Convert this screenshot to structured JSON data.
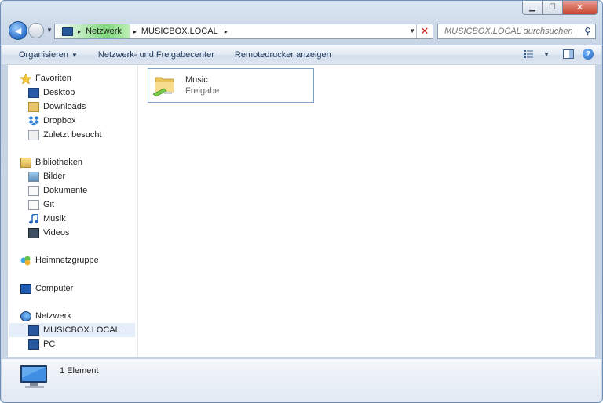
{
  "window": {
    "controls": {
      "minimize": "▁",
      "maximize": "☐",
      "close": "✕"
    }
  },
  "nav": {
    "back_glyph": "◄",
    "breadcrumb": [
      {
        "label": "Netzwerk"
      },
      {
        "label": "MUSICBOX.LOCAL"
      }
    ],
    "chevron": "▸",
    "address_dropdown": "▼",
    "clear": "✕",
    "search_placeholder": "MUSICBOX.LOCAL durchsuchen",
    "search_icon": "⚲"
  },
  "commandbar": {
    "organize": "Organisieren",
    "network_center": "Netzwerk- und Freigabecenter",
    "remote_printers": "Remotedrucker anzeigen"
  },
  "sidebar": {
    "favorites": {
      "label": "Favoriten",
      "items": [
        "Desktop",
        "Downloads",
        "Dropbox",
        "Zuletzt besucht"
      ]
    },
    "libraries": {
      "label": "Bibliotheken",
      "items": [
        "Bilder",
        "Dokumente",
        "Git",
        "Musik",
        "Videos"
      ]
    },
    "homegroup": {
      "label": "Heimnetzgruppe"
    },
    "computer": {
      "label": "Computer"
    },
    "network": {
      "label": "Netzwerk",
      "items": [
        "MUSICBOX.LOCAL",
        "PC"
      ],
      "selected": "MUSICBOX.LOCAL"
    }
  },
  "content": {
    "items": [
      {
        "name": "Music",
        "type": "Freigabe",
        "icon": "shared-folder-icon"
      }
    ]
  },
  "details": {
    "count": "1 Element",
    "icon": "computer-icon"
  },
  "colors": {
    "accent": "#1e395b",
    "selection": "#e5eef9",
    "tile_border": "#7da2ce"
  }
}
